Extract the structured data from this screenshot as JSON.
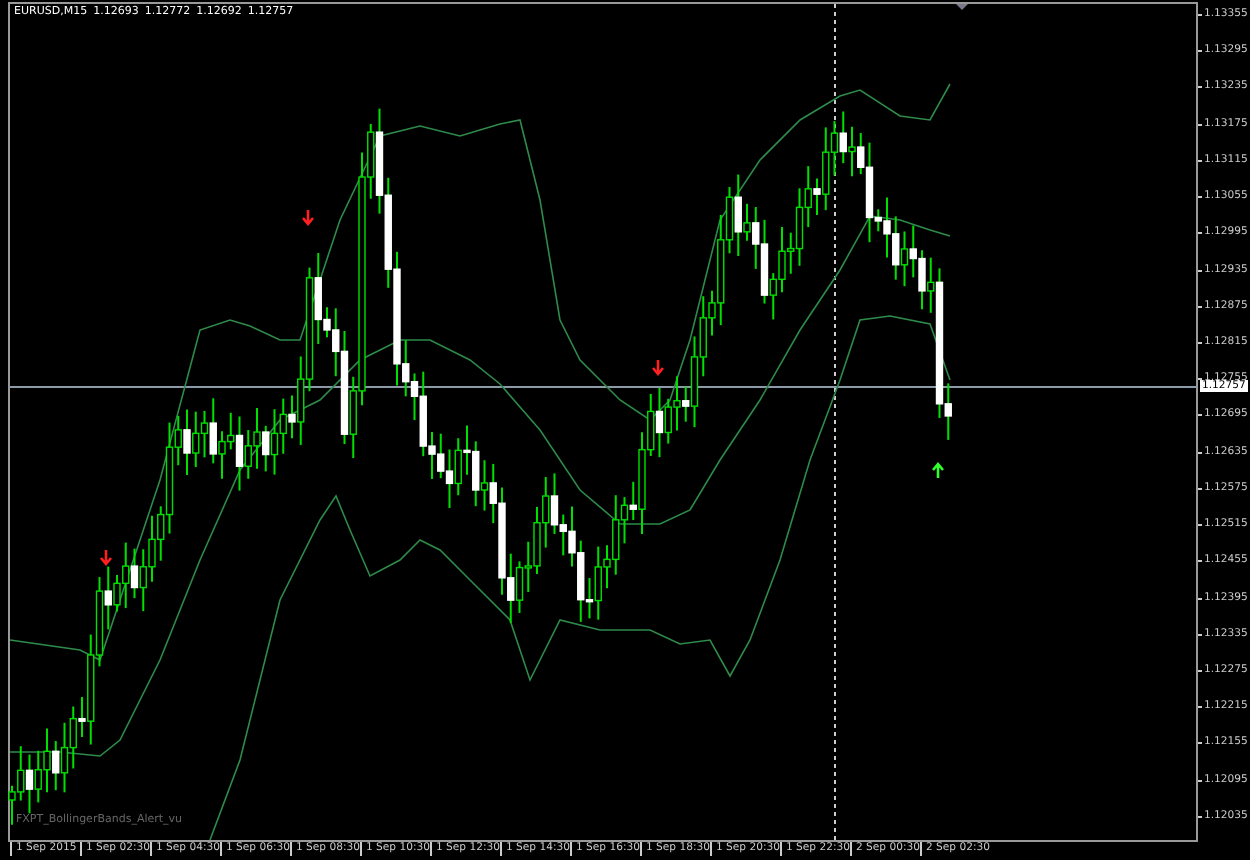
{
  "chart": {
    "symbol": "EURUSD,M15",
    "quotes": [
      "1.12693",
      "1.12772",
      "1.12692",
      "1.12757"
    ],
    "indicator_label": "FXPT_BollingerBands_Alert_vu"
  },
  "price_axis": {
    "labels": [
      "1.13355",
      "1.13295",
      "1.13235",
      "1.13175",
      "1.13115",
      "1.13055",
      "1.12995",
      "1.12935",
      "1.12875",
      "1.12815",
      "1.12755",
      "1.12695",
      "1.12635",
      "1.12575",
      "1.12515",
      "1.12455",
      "1.12395",
      "1.12335",
      "1.12275",
      "1.12215",
      "1.12155",
      "1.12095",
      "1.12035"
    ],
    "current": "1.12757"
  },
  "time_axis": {
    "labels": [
      "1 Sep 2015",
      "1 Sep 02:30",
      "1 Sep 04:30",
      "1 Sep 06:30",
      "1 Sep 08:30",
      "1 Sep 10:30",
      "1 Sep 12:30",
      "1 Sep 14:30",
      "1 Sep 16:30",
      "1 Sep 18:30",
      "1 Sep 20:30",
      "1 Sep 22:30",
      "2 Sep 00:30",
      "2 Sep 02:30"
    ]
  }
}
